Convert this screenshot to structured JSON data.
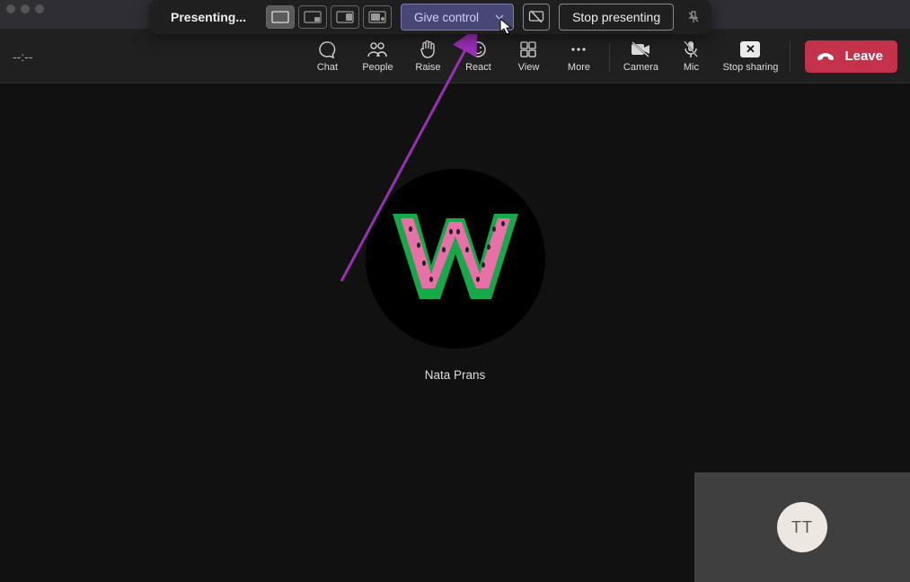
{
  "window": {
    "presenting_label": "Presenting..."
  },
  "present_bar": {
    "give_control_label": "Give control",
    "stop_presenting_label": "Stop presenting"
  },
  "meeting_bar": {
    "timer": "--:--",
    "controls": {
      "chat": "Chat",
      "people": "People",
      "raise": "Raise",
      "react": "React",
      "view": "View",
      "more": "More",
      "camera": "Camera",
      "mic": "Mic",
      "stop_sharing": "Stop sharing"
    },
    "leave_label": "Leave"
  },
  "participant": {
    "name": "Nata Prans",
    "avatar_letter": "W"
  },
  "selfview": {
    "initials": "TT"
  },
  "colors": {
    "accent": "#464775",
    "leave": "#c4314b",
    "annotation": "#9a2fb5"
  }
}
